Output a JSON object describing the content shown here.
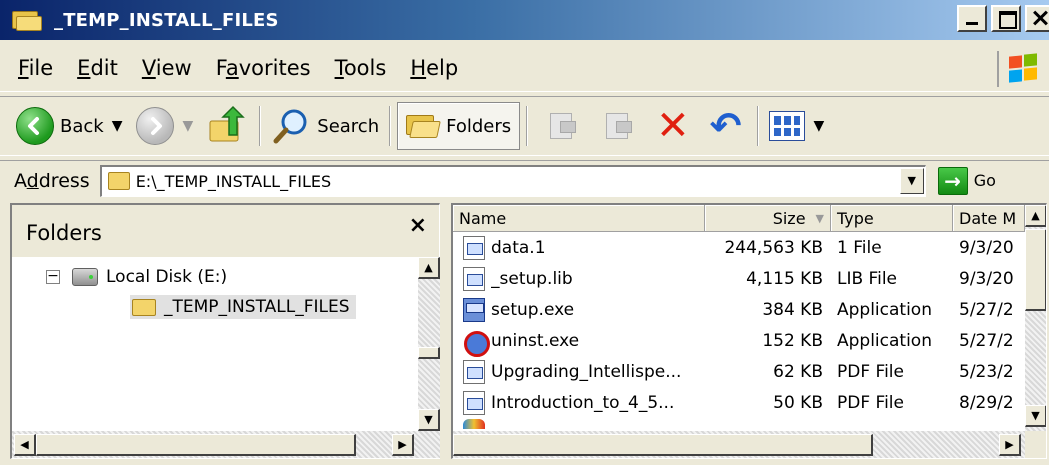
{
  "window": {
    "title": "_TEMP_INSTALL_FILES"
  },
  "menu": {
    "items": [
      {
        "mnemonic": "F",
        "rest": "ile"
      },
      {
        "mnemonic": "E",
        "rest": "dit"
      },
      {
        "mnemonic": "V",
        "rest": "iew"
      },
      {
        "pre": "F",
        "mnemonic": "a",
        "rest": "vorites"
      },
      {
        "mnemonic": "T",
        "rest": "ools"
      },
      {
        "mnemonic": "H",
        "rest": "elp"
      }
    ]
  },
  "toolbar": {
    "back_label": "Back",
    "search_label": "Search",
    "folders_label": "Folders"
  },
  "address": {
    "label_pre": "A",
    "label_mnemonic": "d",
    "label_rest": "dress",
    "path": "E:\\_TEMP_INSTALL_FILES",
    "go_label": "Go"
  },
  "folders_pane": {
    "title": "Folders",
    "close_glyph": "×",
    "tree": [
      {
        "label": "Local Disk (E:)",
        "expander": "−"
      },
      {
        "label": "_TEMP_INSTALL_FILES"
      }
    ]
  },
  "files": {
    "columns": [
      "Name",
      "Size",
      "Type",
      "Date M"
    ],
    "rows": [
      {
        "name": "data.1",
        "size": "244,563 KB",
        "type": "1 File",
        "date": "9/3/20",
        "icon": "doc"
      },
      {
        "name": "_setup.lib",
        "size": "4,115 KB",
        "type": "LIB File",
        "date": "9/3/20",
        "icon": "doc"
      },
      {
        "name": "setup.exe",
        "size": "384 KB",
        "type": "Application",
        "date": "5/27/2",
        "icon": "exe"
      },
      {
        "name": "uninst.exe",
        "size": "152 KB",
        "type": "Application",
        "date": "5/27/2",
        "icon": "uninst"
      },
      {
        "name": "Upgrading_Intellispe...",
        "size": "62 KB",
        "type": "PDF File",
        "date": "5/23/2",
        "icon": "doc"
      },
      {
        "name": "Introduction_to_4_5...",
        "size": "50 KB",
        "type": "PDF File",
        "date": "8/29/2",
        "icon": "doc"
      }
    ]
  },
  "colors": {
    "title_start": "#0a246a",
    "title_end": "#a6caf0",
    "chrome": "#ece9d8",
    "delete_red": "#e02010",
    "go_green": "#138a13"
  }
}
